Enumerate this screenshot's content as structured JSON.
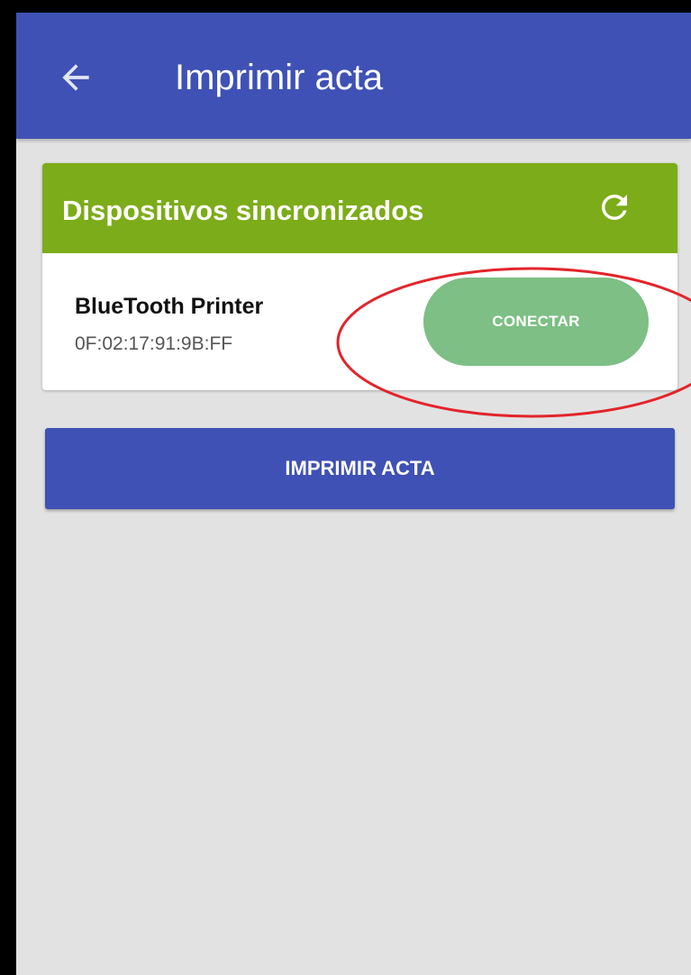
{
  "appbar": {
    "title": "Imprimir acta",
    "back_icon": "arrow-left-icon",
    "background_color": "#3f51b5"
  },
  "devices_card": {
    "title": "Dispositivos sincronizados",
    "refresh_icon": "refresh-icon",
    "header_color": "#7cac19",
    "devices": [
      {
        "name": "BlueTooth Printer",
        "address": "0F:02:17:91:9B:FF",
        "connect_label": "CONECTAR",
        "connect_color": "#7dbf84"
      }
    ]
  },
  "print_button": {
    "label": "IMPRIMIR ACTA"
  },
  "annotation": {
    "highlight_color": "#e3242b"
  }
}
